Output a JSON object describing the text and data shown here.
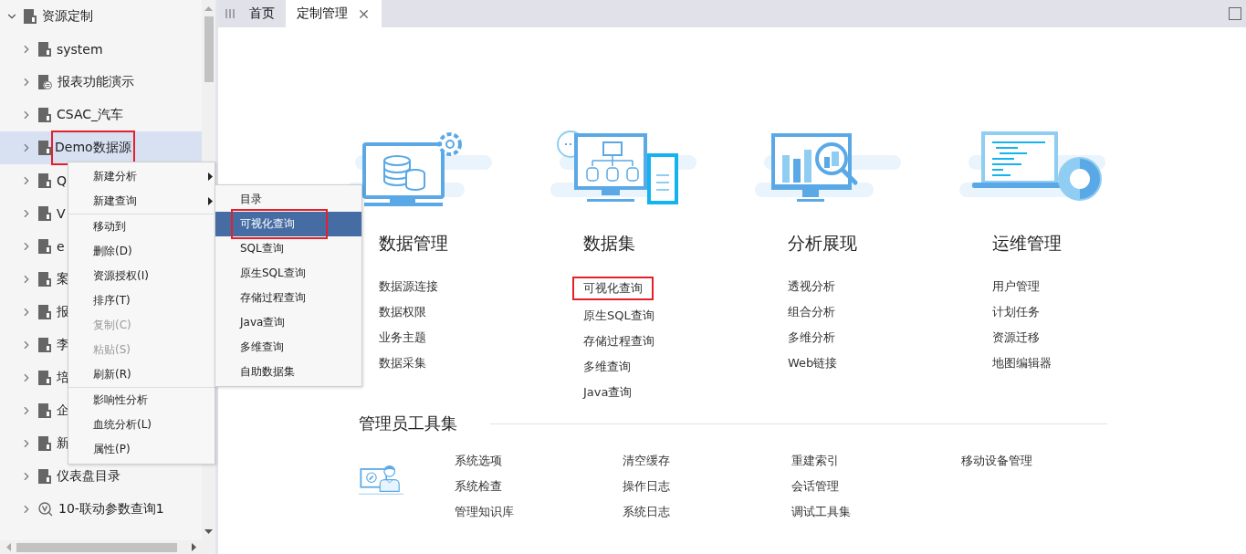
{
  "tree": {
    "label": "资源定制",
    "expanded": true,
    "children": [
      {
        "label": "system",
        "kind": "doc",
        "selected": false,
        "highlighted": false
      },
      {
        "label": "报表功能演示",
        "kind": "report",
        "selected": false,
        "highlighted": false
      },
      {
        "label": "CSAC_汽车",
        "kind": "doc",
        "selected": false,
        "highlighted": false
      },
      {
        "label": "Demo数据源",
        "kind": "doc",
        "selected": true,
        "highlighted": true
      },
      {
        "label": "Q",
        "kind": "doc",
        "selected": false,
        "highlighted": false
      },
      {
        "label": "V",
        "kind": "doc",
        "selected": false,
        "highlighted": false
      },
      {
        "label": "e",
        "kind": "doc",
        "selected": false,
        "highlighted": false
      },
      {
        "label": "案",
        "kind": "doc",
        "selected": false,
        "highlighted": false
      },
      {
        "label": "报",
        "kind": "doc",
        "selected": false,
        "highlighted": false
      },
      {
        "label": "李",
        "kind": "doc",
        "selected": false,
        "highlighted": false
      },
      {
        "label": "培",
        "kind": "doc",
        "selected": false,
        "highlighted": false
      },
      {
        "label": "企",
        "kind": "doc",
        "selected": false,
        "highlighted": false
      },
      {
        "label": "新",
        "kind": "doc",
        "selected": false,
        "highlighted": false
      },
      {
        "label": "仪表盘目录",
        "kind": "doc",
        "selected": false,
        "highlighted": false
      },
      {
        "label": "10-联动参数查询1",
        "kind": "query",
        "selected": false,
        "highlighted": false
      }
    ]
  },
  "context_menu": {
    "items": [
      {
        "label": "新建分析",
        "submenu": true,
        "disabled": false,
        "separator_after": false
      },
      {
        "label": "新建查询",
        "submenu": true,
        "disabled": false,
        "separator_after": true
      },
      {
        "label": "移动到",
        "submenu": false,
        "disabled": false,
        "separator_after": false
      },
      {
        "label": "删除(D)",
        "submenu": false,
        "disabled": false,
        "separator_after": false
      },
      {
        "label": "资源授权(I)",
        "submenu": false,
        "disabled": false,
        "separator_after": false
      },
      {
        "label": "排序(T)",
        "submenu": false,
        "disabled": false,
        "separator_after": false
      },
      {
        "label": "复制(C)",
        "submenu": false,
        "disabled": true,
        "separator_after": false
      },
      {
        "label": "粘贴(S)",
        "submenu": false,
        "disabled": true,
        "separator_after": false
      },
      {
        "label": "刷新(R)",
        "submenu": false,
        "disabled": false,
        "separator_after": true
      },
      {
        "label": "影响性分析",
        "submenu": false,
        "disabled": false,
        "separator_after": false
      },
      {
        "label": "血统分析(L)",
        "submenu": false,
        "disabled": false,
        "separator_after": false
      },
      {
        "label": "属性(P)",
        "submenu": false,
        "disabled": false,
        "separator_after": false
      }
    ]
  },
  "submenu": {
    "items": [
      {
        "label": "目录",
        "selected": false,
        "highlighted": false
      },
      {
        "label": "可视化查询",
        "selected": true,
        "highlighted": true
      },
      {
        "label": "SQL查询",
        "selected": false,
        "highlighted": false
      },
      {
        "label": "原生SQL查询",
        "selected": false,
        "highlighted": false
      },
      {
        "label": "存储过程查询",
        "selected": false,
        "highlighted": false
      },
      {
        "label": "Java查询",
        "selected": false,
        "highlighted": false
      },
      {
        "label": "多维查询",
        "selected": false,
        "highlighted": false
      },
      {
        "label": "自助数据集",
        "selected": false,
        "highlighted": false
      }
    ]
  },
  "tabs": [
    {
      "label": "首页",
      "selected": false,
      "closable": false
    },
    {
      "label": "定制管理",
      "selected": true,
      "closable": true
    }
  ],
  "modules": [
    {
      "title": "数据管理",
      "kind": "database",
      "links": [
        {
          "label": "数据源连接",
          "highlighted": false
        },
        {
          "label": "数据权限",
          "highlighted": false
        },
        {
          "label": "业务主题",
          "highlighted": false
        },
        {
          "label": "数据采集",
          "highlighted": false
        }
      ]
    },
    {
      "title": "数据集",
      "kind": "dataset",
      "links": [
        {
          "label": "可视化查询",
          "highlighted": true
        },
        {
          "label": "原生SQL查询",
          "highlighted": false
        },
        {
          "label": "存储过程查询",
          "highlighted": false
        },
        {
          "label": "多维查询",
          "highlighted": false
        },
        {
          "label": "Java查询",
          "highlighted": false
        }
      ]
    },
    {
      "title": "分析展现",
      "kind": "analysis",
      "links": [
        {
          "label": "透视分析",
          "highlighted": false
        },
        {
          "label": "组合分析",
          "highlighted": false
        },
        {
          "label": "多维分析",
          "highlighted": false
        },
        {
          "label": "Web链接",
          "highlighted": false
        }
      ]
    },
    {
      "title": "运维管理",
      "kind": "ops",
      "links": [
        {
          "label": "用户管理",
          "highlighted": false
        },
        {
          "label": "计划任务",
          "highlighted": false
        },
        {
          "label": "资源迁移",
          "highlighted": false
        },
        {
          "label": "地图编辑器",
          "highlighted": false
        }
      ]
    }
  ],
  "admin_tools": {
    "title": "管理员工具集",
    "columns": [
      [
        "系统选项",
        "系统检查",
        "管理知识库"
      ],
      [
        "清空缓存",
        "操作日志",
        "系统日志"
      ],
      [
        "重建索引",
        "会话管理",
        "调试工具集"
      ],
      [
        "移动设备管理"
      ]
    ]
  }
}
